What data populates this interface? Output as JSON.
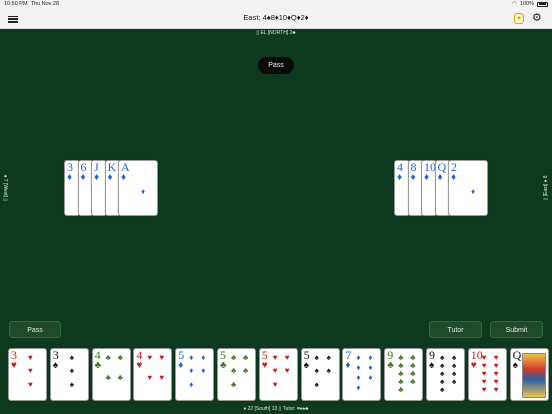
{
  "status": {
    "time": "10:50 PM",
    "date": "Thu Nov 28",
    "battery": "100%"
  },
  "nav": {
    "title": "East: 4♠8♦10♦Q♦2♦"
  },
  "north": {
    "info": "▯ EL  [NORTH]  2♣"
  },
  "west": {
    "info": "♦ 7  [West]  ▯"
  },
  "east": {
    "info": "▯  [East]  ♦ 8"
  },
  "south": {
    "info": "♦ 22  [South]  13 ▯  Tutor: ♥♦♠♣"
  },
  "bid_pill": "Pass",
  "buttons": {
    "pass": "Pass",
    "tutor": "Tutor",
    "submit": "Submit"
  },
  "west_trick": [
    {
      "rank": "3",
      "suit": "♦"
    },
    {
      "rank": "6",
      "suit": "♦"
    },
    {
      "rank": "J",
      "suit": "♦"
    },
    {
      "rank": "K",
      "suit": "♦"
    },
    {
      "rank": "A",
      "suit": "♦"
    }
  ],
  "east_trick": [
    {
      "rank": "4",
      "suit": "♦"
    },
    {
      "rank": "8",
      "suit": "♦"
    },
    {
      "rank": "10",
      "suit": "♦"
    },
    {
      "rank": "Q",
      "suit": "♦"
    },
    {
      "rank": "2",
      "suit": "♦"
    }
  ],
  "hand": [
    {
      "rank": "3",
      "suit": "♥",
      "color": "#c81e1e"
    },
    {
      "rank": "3",
      "suit": "♠",
      "color": "#111111"
    },
    {
      "rank": "4",
      "suit": "♣",
      "color": "#3b7a1d"
    },
    {
      "rank": "4",
      "suit": "♥",
      "color": "#c81e1e"
    },
    {
      "rank": "5",
      "suit": "♦",
      "color": "#1f64d9"
    },
    {
      "rank": "5",
      "suit": "♣",
      "color": "#3b7a1d"
    },
    {
      "rank": "5",
      "suit": "♥",
      "color": "#c81e1e"
    },
    {
      "rank": "5",
      "suit": "♠",
      "color": "#111111"
    },
    {
      "rank": "7",
      "suit": "♦",
      "color": "#1f64d9"
    },
    {
      "rank": "9",
      "suit": "♣",
      "color": "#3b7a1d"
    },
    {
      "rank": "9",
      "suit": "♠",
      "color": "#111111"
    },
    {
      "rank": "10",
      "suit": "♥",
      "color": "#c81e1e"
    },
    {
      "rank": "Q",
      "suit": "♠",
      "color": "#111111"
    }
  ]
}
